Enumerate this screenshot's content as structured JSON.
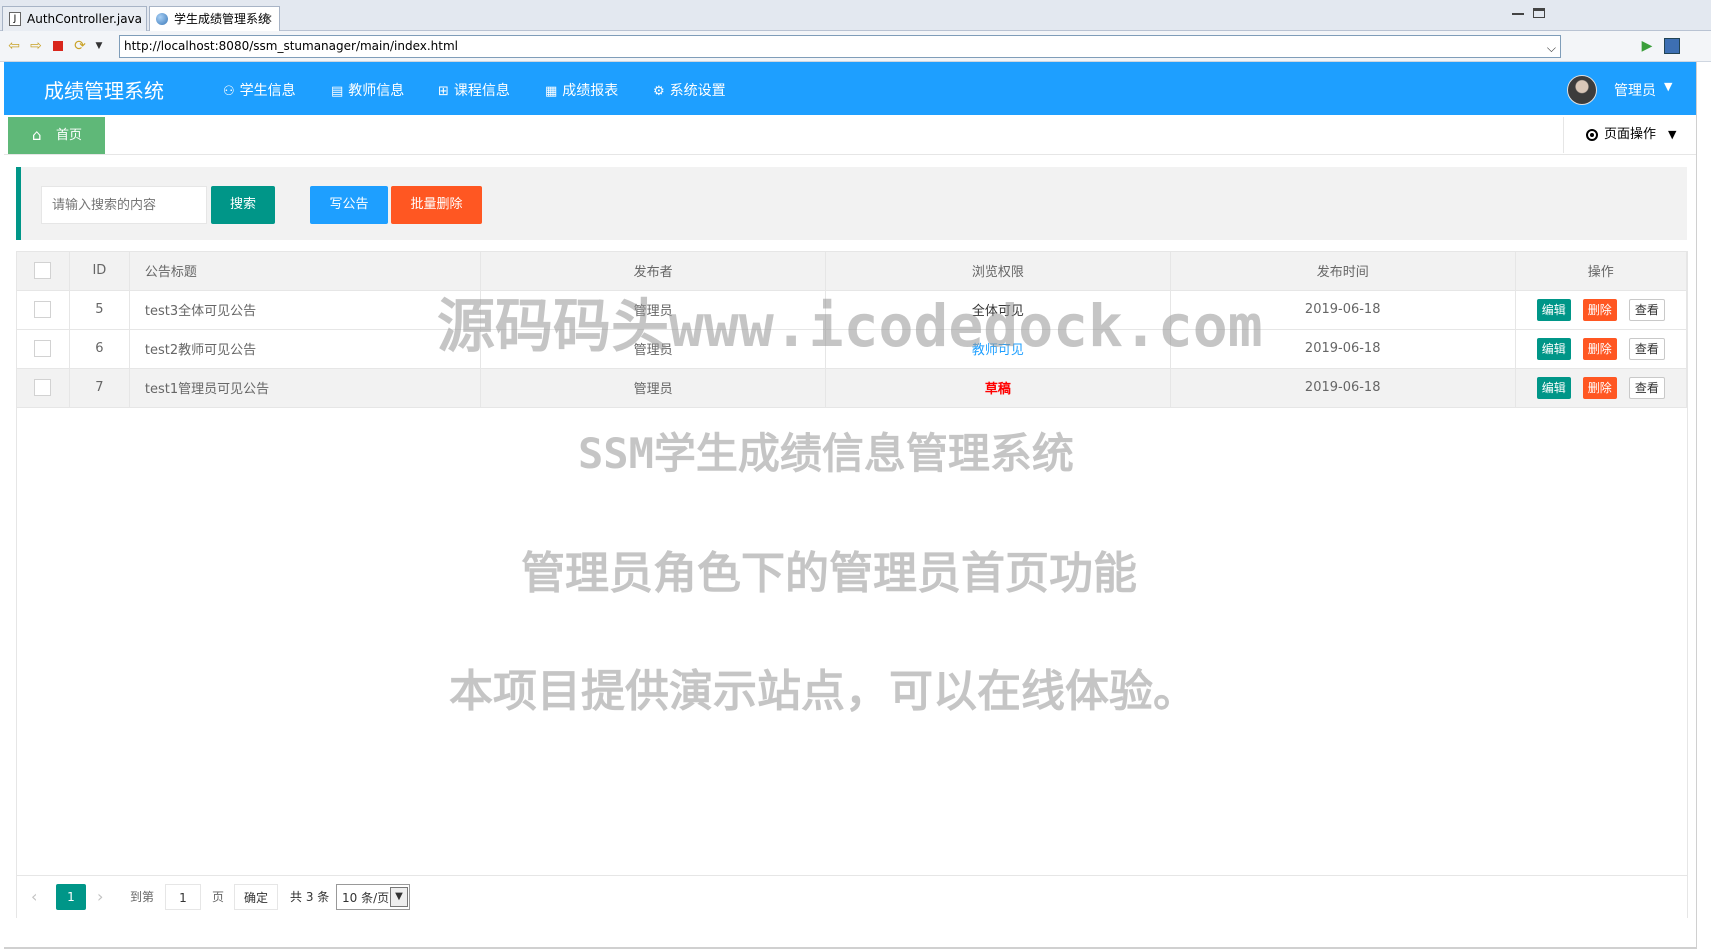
{
  "ide_tabs": [
    {
      "label": "AuthController.java",
      "icon": "java-file-icon"
    },
    {
      "label": "学生成绩管理系统",
      "icon": "globe-icon"
    }
  ],
  "address_bar": {
    "url": "http://localhost:8080/ssm_stumanager/main/index.html"
  },
  "header": {
    "title": "成绩管理系统",
    "menu": [
      {
        "label": "学生信息",
        "icon": "users-icon"
      },
      {
        "label": "教师信息",
        "icon": "document-icon"
      },
      {
        "label": "课程信息",
        "icon": "book-icon"
      },
      {
        "label": "成绩报表",
        "icon": "table-icon"
      },
      {
        "label": "系统设置",
        "icon": "gear-icon"
      }
    ],
    "user": "管理员"
  },
  "tabs": {
    "home": "首页",
    "page_ops": "页面操作"
  },
  "toolbar": {
    "search_placeholder": "请输入搜索的内容",
    "search_label": "搜索",
    "write_label": "写公告",
    "batch_delete_label": "批量删除"
  },
  "table": {
    "headers": [
      "ID",
      "公告标题",
      "发布者",
      "浏览权限",
      "发布时间",
      "操作"
    ],
    "rows": [
      {
        "id": "5",
        "title": "test3全体可见公告",
        "publisher": "管理员",
        "permission": "全体可见",
        "time": "2019-06-18"
      },
      {
        "id": "6",
        "title": "test2教师可见公告",
        "publisher": "管理员",
        "permission": "教师可见",
        "time": "2019-06-18"
      },
      {
        "id": "7",
        "title": "test1管理员可见公告",
        "publisher": "管理员",
        "permission": "草稿",
        "time": "2019-06-18"
      }
    ],
    "actions": {
      "edit": "编辑",
      "delete": "删除",
      "view": "查看"
    }
  },
  "pager": {
    "current_page": "1",
    "goto_label": "到第",
    "page_input": "1",
    "page_unit": "页",
    "confirm_label": "确定",
    "total": "共 3 条",
    "page_size": "10 条/页"
  },
  "watermarks": [
    "源码码头www.icodedock.com",
    "SSM学生成绩信息管理系统",
    "管理员角色下的管理员首页功能",
    "本项目提供演示站点，可以在线体验。"
  ]
}
